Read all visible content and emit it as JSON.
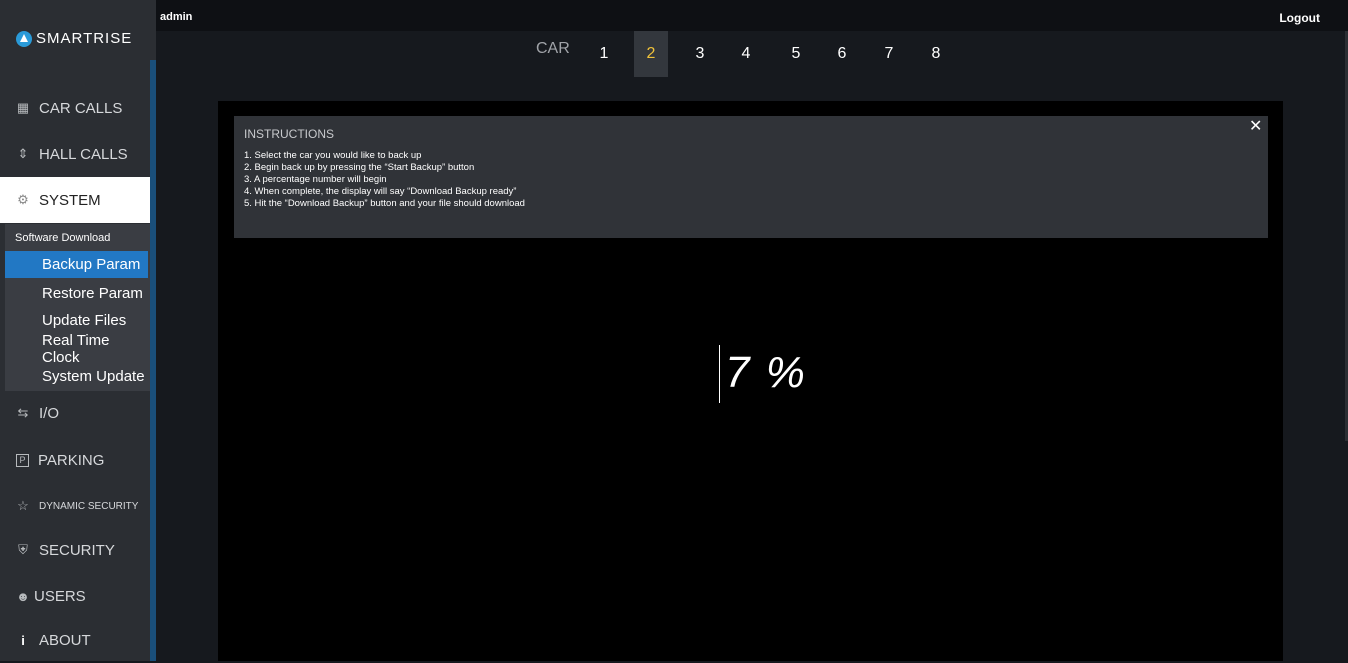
{
  "header": {
    "user": "admin",
    "logout_label": "Logout"
  },
  "brand": {
    "name": "SMARTRISE"
  },
  "sidebar": {
    "items": [
      {
        "label": "CAR CALLS",
        "icon": "keypad-icon"
      },
      {
        "label": "HALL CALLS",
        "icon": "up-down-chevron-icon"
      },
      {
        "label": "SYSTEM",
        "icon": "gear-icon"
      },
      {
        "label": "I/O",
        "icon": "swap-arrows-icon"
      },
      {
        "label": "PARKING",
        "icon": "parking-icon"
      },
      {
        "label": "DYNAMIC SECURITY",
        "icon": "star-icon"
      },
      {
        "label": "SECURITY",
        "icon": "shield-icon"
      },
      {
        "label": "USERS",
        "icon": "users-icon"
      },
      {
        "label": "ABOUT",
        "icon": "info-icon"
      }
    ],
    "system_sub": [
      {
        "label": "Software Download"
      },
      {
        "label": "Backup Param"
      },
      {
        "label": "Restore Param"
      },
      {
        "label": "Update Files"
      },
      {
        "label": "Real Time Clock"
      },
      {
        "label": "System Update"
      }
    ]
  },
  "car_selector": {
    "label": "CAR",
    "cars": [
      "1",
      "2",
      "3",
      "4",
      "5",
      "6",
      "7",
      "8"
    ],
    "selected": "2"
  },
  "instructions": {
    "title": "INSTRUCTIONS",
    "lines": [
      "1. Select the car you would like to back up",
      "2. Begin back up by pressing the “Start Backup” button",
      "3. A percentage number will begin",
      "4. When complete, the display will say “Download Backup ready”",
      "5. Hit the “Download Backup” button and your file should download"
    ]
  },
  "progress": {
    "percent_text": "7 %",
    "value": 7
  },
  "colors": {
    "accent": "#2278c4",
    "selected_car": "#f0c23a",
    "brand": "#2a9ad8"
  }
}
